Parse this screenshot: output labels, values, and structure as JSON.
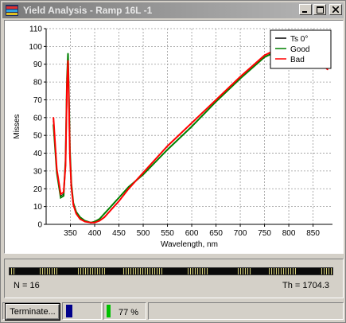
{
  "window": {
    "title": "Yield Analysis - Ramp 16L -1",
    "min_label": "_",
    "max_label": "□",
    "close_label": "×"
  },
  "chart_data": {
    "type": "line",
    "xlabel": "Wavelength, nm",
    "ylabel": "Misses",
    "xlim": [
      300,
      890
    ],
    "ylim": [
      0,
      110
    ],
    "xticks": [
      350,
      400,
      450,
      500,
      550,
      600,
      650,
      700,
      750,
      800,
      850
    ],
    "yticks": [
      0,
      10,
      20,
      30,
      40,
      50,
      60,
      70,
      80,
      90,
      100,
      110
    ],
    "grid": true,
    "legend_position": "top-right",
    "series": [
      {
        "name": "Ts 0°",
        "color": "#000000",
        "x": [
          315,
          322,
          330,
          336,
          340,
          343,
          345,
          347,
          349,
          352,
          356,
          362,
          370,
          380,
          392,
          400,
          410,
          420,
          430,
          440,
          450,
          470,
          500,
          550,
          600,
          650,
          700,
          750,
          780,
          800,
          815,
          830,
          850,
          865,
          880
        ],
        "y": [
          58,
          30,
          16,
          17,
          35,
          80,
          94,
          70,
          40,
          22,
          12,
          7,
          4,
          2,
          1,
          1.5,
          3,
          6,
          9,
          12,
          15,
          21,
          28,
          42,
          55,
          69,
          82,
          94,
          98,
          100,
          100,
          99,
          96,
          92,
          88
        ]
      },
      {
        "name": "Good",
        "color": "#008000",
        "x": [
          315,
          322,
          330,
          336,
          340,
          343,
          345,
          347,
          349,
          352,
          356,
          362,
          370,
          380,
          392,
          400,
          410,
          420,
          430,
          440,
          450,
          470,
          500,
          550,
          600,
          650,
          700,
          750,
          780,
          800,
          815,
          830,
          850,
          865,
          880
        ],
        "y": [
          56,
          29,
          15,
          16,
          36,
          82,
          96,
          72,
          42,
          23,
          12,
          7,
          4,
          2,
          1,
          1.5,
          3,
          6,
          9,
          12,
          15,
          21,
          28,
          42,
          55,
          69,
          82,
          94,
          98,
          100,
          100,
          99,
          96,
          92,
          88
        ]
      },
      {
        "name": "Bad",
        "color": "#ff0000",
        "x": [
          315,
          322,
          330,
          336,
          340,
          343,
          345,
          347,
          349,
          352,
          356,
          362,
          370,
          380,
          392,
          400,
          410,
          420,
          430,
          440,
          450,
          470,
          500,
          550,
          600,
          650,
          700,
          750,
          780,
          800,
          815,
          830,
          850,
          865,
          880
        ],
        "y": [
          60,
          31,
          17,
          18,
          33,
          78,
          92,
          68,
          38,
          21,
          11,
          6,
          3,
          1.5,
          1,
          1,
          2,
          4,
          7,
          10,
          13,
          20,
          29,
          44,
          57,
          70,
          83,
          95,
          99,
          100,
          100,
          98,
          95,
          91,
          87
        ]
      }
    ]
  },
  "status": {
    "n_text": "N = 16",
    "th_text": "Th = 1704.3"
  },
  "statusbar": {
    "terminate_label": "Terminate...",
    "progress_percent": 77,
    "progress_text": "77 %",
    "indicator_color": "#00008b",
    "progress_color": "#00c000"
  }
}
